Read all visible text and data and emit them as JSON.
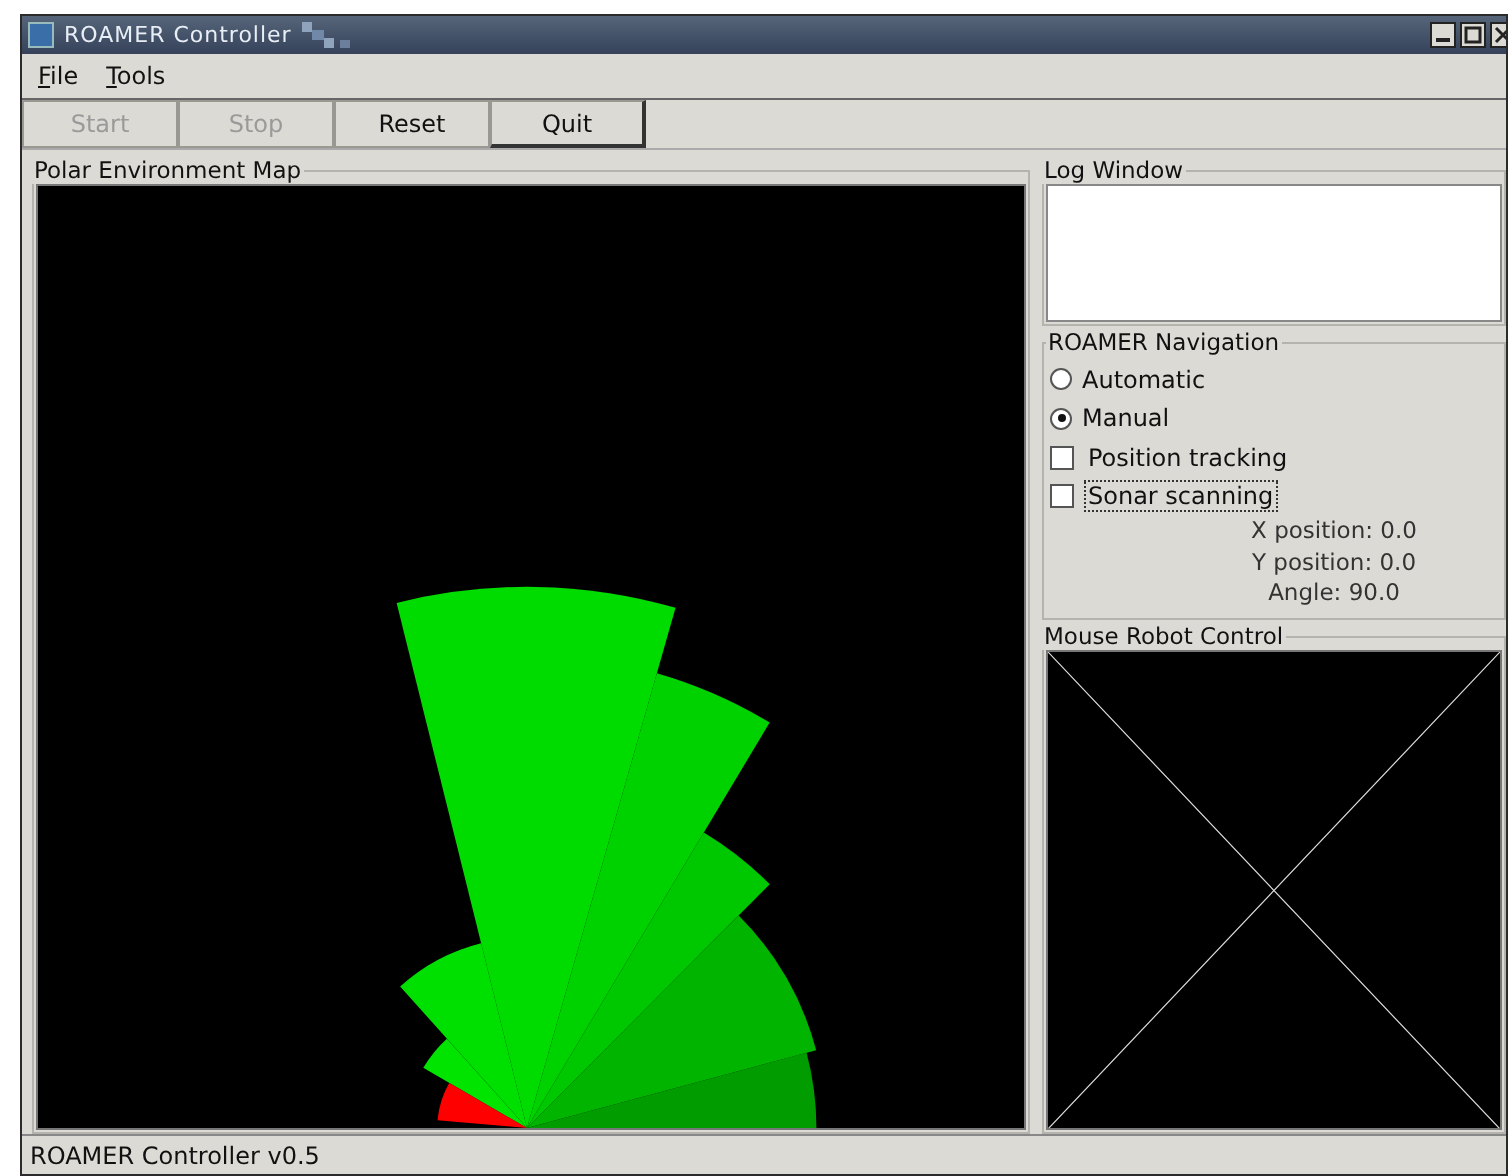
{
  "window": {
    "title": "ROAMER Controller"
  },
  "menu": [
    {
      "label": "File"
    },
    {
      "label": "Tools"
    }
  ],
  "toolbar": [
    {
      "label": "Start",
      "disabled": true
    },
    {
      "label": "Stop",
      "disabled": true
    },
    {
      "label": "Reset",
      "disabled": false
    },
    {
      "label": "Quit",
      "disabled": false
    }
  ],
  "map_panel": {
    "title": "Polar Environment Map"
  },
  "log_panel": {
    "title": "Log Window"
  },
  "navigation": {
    "title": "ROAMER Navigation",
    "modes": [
      {
        "label": "Automatic",
        "selected": false
      },
      {
        "label": "Manual",
        "selected": true
      }
    ],
    "options": [
      {
        "label": "Position tracking",
        "checked": false,
        "focused": false
      },
      {
        "label": "Sonar scanning",
        "checked": false,
        "focused": true
      }
    ],
    "readouts": [
      "X position: 0.0",
      "Y position: 0.0",
      "Angle: 90.0"
    ]
  },
  "mouse_panel": {
    "title": "Mouse Robot Control"
  },
  "status_bar": {
    "text": "ROAMER Controller v0.5"
  }
}
